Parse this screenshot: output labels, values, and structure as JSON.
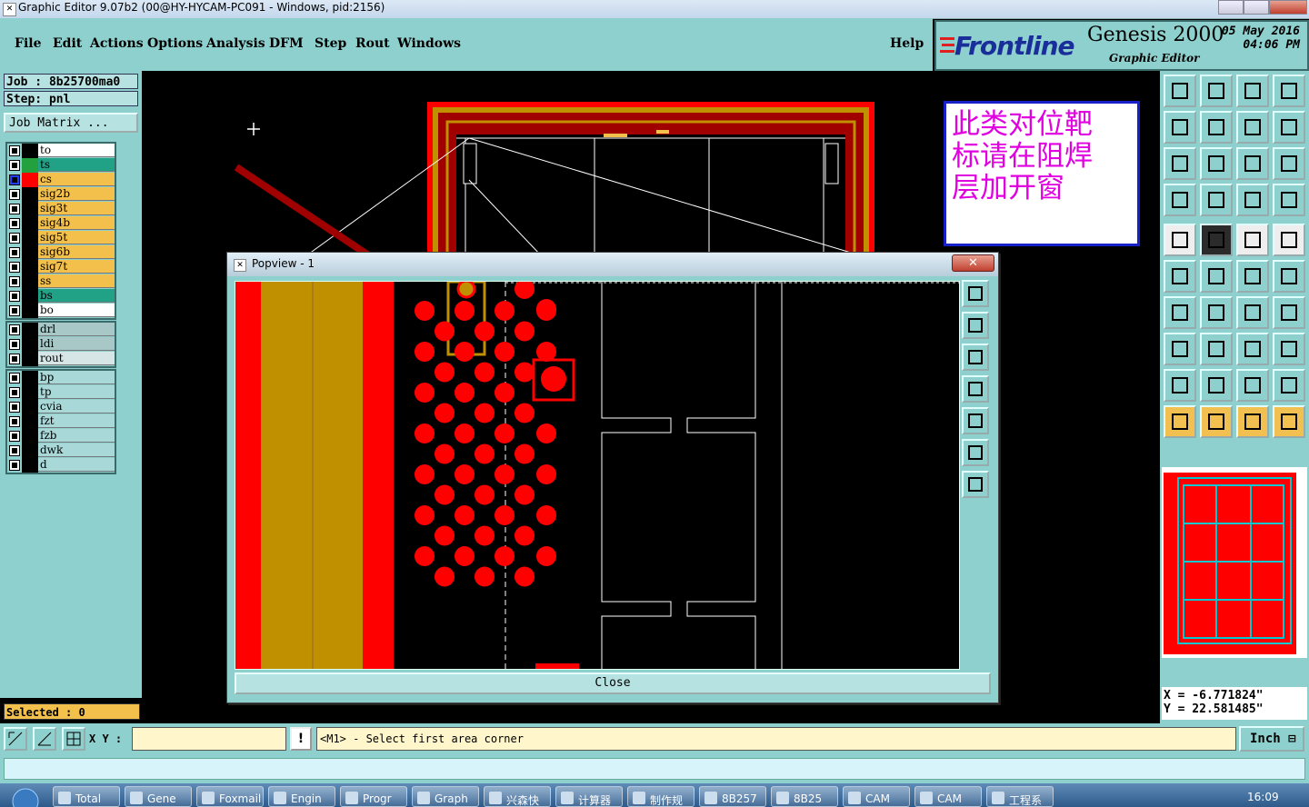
{
  "window": {
    "title": "Graphic Editor 9.07b2 (00@HY-HYCAM-PC091 - Windows, pid:2156)"
  },
  "menu": {
    "items": [
      "File",
      "Edit",
      "Actions",
      "Options",
      "Analysis",
      "DFM",
      "Step",
      "Rout",
      "Windows"
    ],
    "help": "Help"
  },
  "logo": {
    "brand": "Frontline",
    "product": "Genesis 2000",
    "subtitle": "Graphic Editor",
    "date": "05 May 2016",
    "time": "04:06 PM"
  },
  "job": {
    "job_label": "Job : 8b25700ma0",
    "step_label": "Step: pnl",
    "matrix_button": "Job Matrix ..."
  },
  "layers": {
    "group1": [
      {
        "name": "to",
        "color": "#ffffff",
        "swatch": "#000000"
      },
      {
        "name": "ts",
        "color": "#21a186",
        "swatch": "#23a13f"
      },
      {
        "name": "cs",
        "color": "#f3c14b",
        "swatch": "#ff0000",
        "active": true
      },
      {
        "name": "sig2b",
        "color": "#f3c14b"
      },
      {
        "name": "sig3t",
        "color": "#f3c14b"
      },
      {
        "name": "sig4b",
        "color": "#f3c14b"
      },
      {
        "name": "sig5t",
        "color": "#f3c14b"
      },
      {
        "name": "sig6b",
        "color": "#f3c14b"
      },
      {
        "name": "sig7t",
        "color": "#f3c14b"
      },
      {
        "name": "ss",
        "color": "#f3c14b"
      },
      {
        "name": "bs",
        "color": "#21a186"
      },
      {
        "name": "bo",
        "color": "#ffffff"
      }
    ],
    "group2": [
      {
        "name": "drl",
        "color": "#a8c8c8"
      },
      {
        "name": "ldi",
        "color": "#a8c8c8"
      },
      {
        "name": "rout",
        "color": "#d6e6e6"
      }
    ],
    "group3": [
      {
        "name": "bp",
        "color": "#a8d8d8"
      },
      {
        "name": "tp",
        "color": "#a8d8d8"
      },
      {
        "name": "cvia",
        "color": "#a8d8d8"
      },
      {
        "name": "fzt",
        "color": "#a8d8d8"
      },
      {
        "name": "fzb",
        "color": "#a8d8d8"
      },
      {
        "name": "dwk",
        "color": "#a8d8d8"
      },
      {
        "name": "d",
        "color": "#a8d8d8"
      }
    ]
  },
  "selected": "Selected : 0",
  "note": {
    "lines": [
      "此类对位靶",
      "标请在阻焊",
      "层加开窗"
    ]
  },
  "coords": {
    "x": "X = -6.771824\"",
    "y": "Y = 22.581485\""
  },
  "popview": {
    "title": "Popview - 1",
    "close_label": "Close"
  },
  "bottom": {
    "xy_label": "X Y :",
    "xy_value": "",
    "status": "<M1> - Select first area corner",
    "unit": "Inch",
    "excl": "!"
  },
  "taskbar": {
    "items": [
      "Total",
      "Gene",
      "Foxmail",
      "Engin",
      "Progr",
      "Graph",
      "兴森快",
      "计算器",
      "制作规",
      "8B257",
      "8B25",
      "CAM",
      "CAM",
      "工程系"
    ],
    "clock": "16:09"
  },
  "colors": {
    "panel": "#8ed0cd",
    "copper": "#ff0000",
    "gold": "#c09000",
    "border_dark": "#3a6b6a"
  }
}
